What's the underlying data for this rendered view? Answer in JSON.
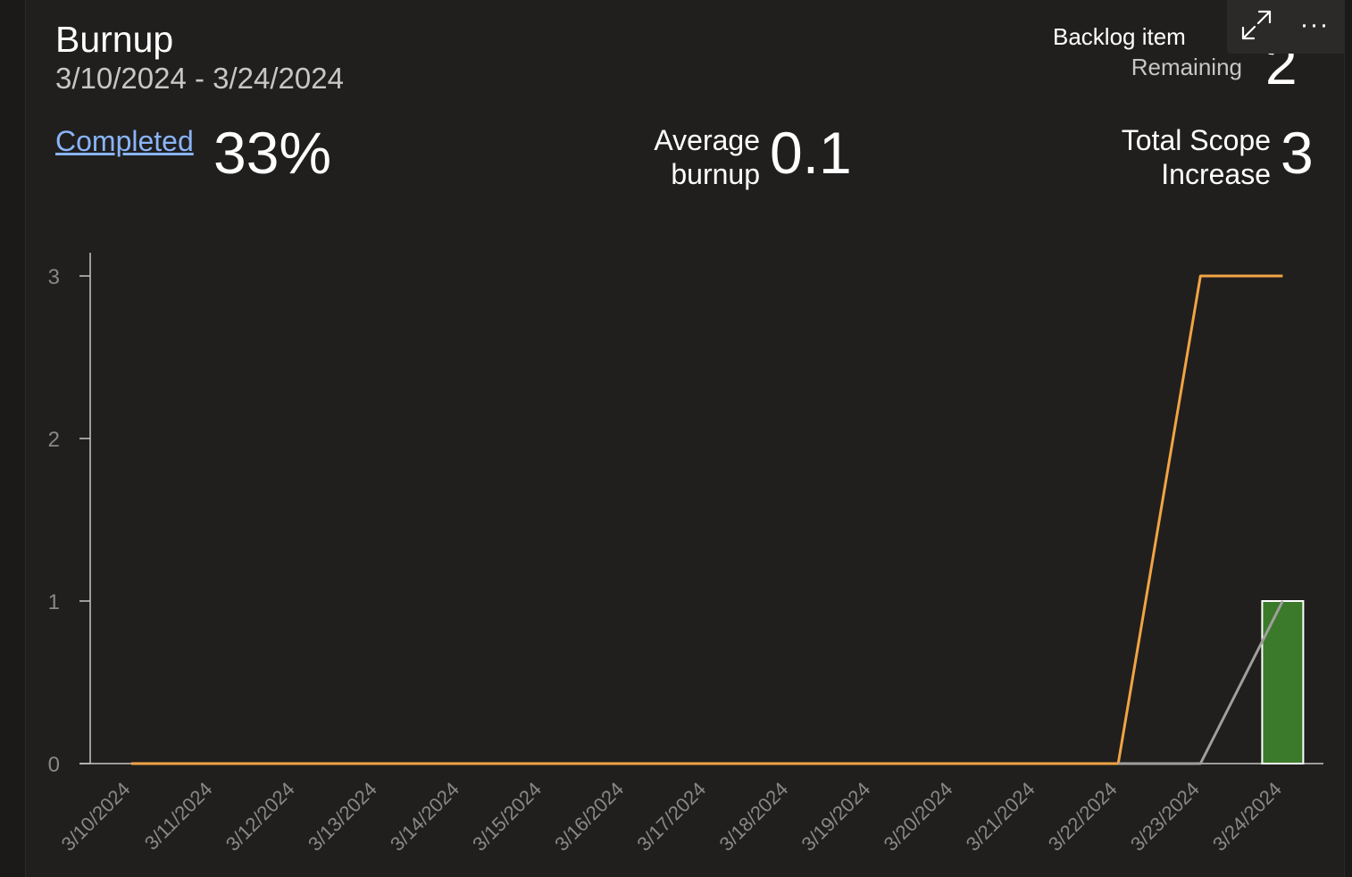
{
  "widget": {
    "title": "Burnup",
    "date_range": "3/10/2024 - 3/24/2024"
  },
  "metrics": {
    "completed_label": "Completed",
    "completed_value": "33%",
    "average_label_line1": "Average",
    "average_label_line2": "burnup",
    "average_value": "0.1",
    "scope_label_line1": "Total Scope",
    "scope_label_line2": "Increase",
    "scope_value": "3",
    "backlog_label": "Backlog item",
    "remaining_label": "Remaining",
    "remaining_value": "2"
  },
  "toolbar": {
    "expand_icon": "expand-icon",
    "more_icon": "more-icon",
    "more_glyph": "···"
  },
  "colors": {
    "total_scope": "#f2a444",
    "completed_line": "#a19f9d",
    "completed_bar": "#3a7a2a",
    "axis": "#c8c6c4",
    "tick_text": "#8a8886",
    "link": "#8ab4f8"
  },
  "chart_data": {
    "type": "line",
    "categories": [
      "3/10/2024",
      "3/11/2024",
      "3/12/2024",
      "3/13/2024",
      "3/14/2024",
      "3/15/2024",
      "3/16/2024",
      "3/17/2024",
      "3/18/2024",
      "3/19/2024",
      "3/20/2024",
      "3/21/2024",
      "3/22/2024",
      "3/23/2024",
      "3/24/2024"
    ],
    "yticks": [
      0,
      1,
      2,
      3
    ],
    "ylim": [
      0,
      3
    ],
    "grid": false,
    "series": [
      {
        "type": "line",
        "color": "#f2a444",
        "values": [
          0,
          0,
          0,
          0,
          0,
          0,
          0,
          0,
          0,
          0,
          0,
          0,
          0,
          3,
          3
        ]
      },
      {
        "type": "line",
        "color": "#a19f9d",
        "values": [
          null,
          null,
          null,
          null,
          null,
          null,
          null,
          null,
          null,
          null,
          null,
          null,
          0,
          0,
          1
        ]
      },
      {
        "type": "bar",
        "color": "#3a7a2a",
        "values": [
          0,
          0,
          0,
          0,
          0,
          0,
          0,
          0,
          0,
          0,
          0,
          0,
          0,
          0,
          1
        ]
      }
    ]
  }
}
